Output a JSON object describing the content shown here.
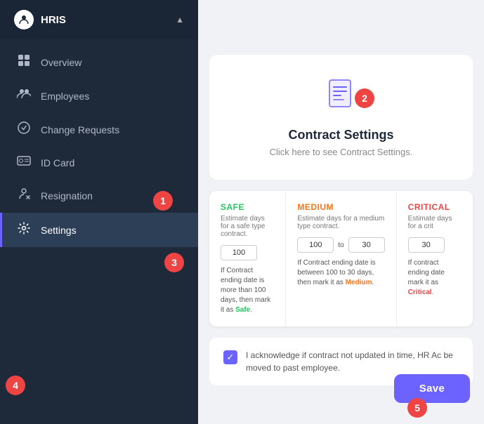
{
  "sidebar": {
    "header": {
      "title": "HRIS",
      "icon": "👤"
    },
    "items": [
      {
        "id": "overview",
        "label": "Overview",
        "icon": "⊞",
        "active": false
      },
      {
        "id": "employees",
        "label": "Employees",
        "icon": "👥",
        "active": false
      },
      {
        "id": "change-requests",
        "label": "Change Requests",
        "icon": "✅",
        "active": false
      },
      {
        "id": "id-card",
        "label": "ID Card",
        "icon": "🪪",
        "active": false
      },
      {
        "id": "resignation",
        "label": "Resignation",
        "icon": "🚶",
        "active": false
      },
      {
        "id": "settings",
        "label": "Settings",
        "icon": "⚙",
        "active": true
      }
    ]
  },
  "contract_settings": {
    "title": "Contract Settings",
    "subtitle": "Click here to see Contract Settings."
  },
  "safe_card": {
    "label": "SAFE",
    "description": "Estimate days for a safe type contract.",
    "input_value": "100",
    "note_prefix": "If Contract ending date is more than 100 days, then mark it as",
    "note_colored": "Safe",
    "color_class": "safe"
  },
  "medium_card": {
    "label": "MEDIUM",
    "description": "Estimate days for a medium type contract.",
    "input_from": "100",
    "input_to": "30",
    "note_prefix": "If Contract ending date is between 100 to 30 days, then mark it as",
    "note_colored": "Medium",
    "color_class": "medium"
  },
  "critical_card": {
    "label": "CRITICAL",
    "description": "Estimate days for a crit",
    "input_value": "30",
    "note_prefix": "If contract ending date mark it as",
    "note_colored": "Critical",
    "color_class": "critical"
  },
  "acknowledgement": {
    "text": "I acknowledge if contract not updated in time, HR Ac be moved to past employee.",
    "checked": true
  },
  "save_button": {
    "label": "Save"
  },
  "badges": {
    "b1": "1",
    "b2": "2",
    "b3": "3",
    "b4": "4",
    "b5": "5"
  }
}
